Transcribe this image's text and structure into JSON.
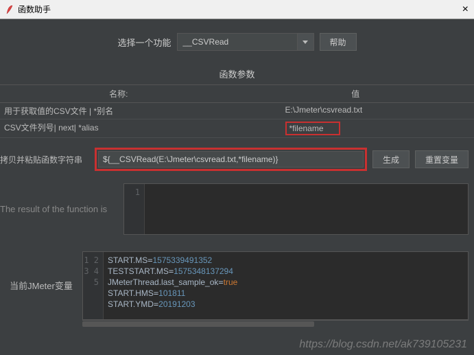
{
  "window": {
    "title": "函数助手"
  },
  "selector": {
    "label": "选择一个功能",
    "value": "__CSVRead",
    "help": "帮助"
  },
  "params": {
    "title": "函数参数",
    "head_name": "名称:",
    "head_value": "值",
    "rows": [
      {
        "name": "用于获取值的CSV文件 | *别名",
        "value": "E:\\Jmeter\\csvread.txt",
        "hl": false
      },
      {
        "name": "CSV文件列号| next| *alias",
        "value": "*filename",
        "hl": true
      }
    ]
  },
  "funcstr": {
    "label": "拷贝并粘贴函数字符串",
    "value": "${__CSVRead(E:\\Jmeter\\csvread.txt,*filename)}",
    "generate": "生成",
    "reset": "重置变量"
  },
  "result": {
    "label": "The result of the function is",
    "lines": [
      ""
    ]
  },
  "vars": {
    "label": "当前JMeter变量",
    "lines": [
      {
        "k": "START.MS",
        "v": "1575339491352"
      },
      {
        "k": "TESTSTART.MS",
        "v": "1575348137294"
      },
      {
        "k": "JMeterThread.last_sample_ok",
        "v": "true",
        "bool": true
      },
      {
        "k": "START.HMS",
        "v": "101811"
      },
      {
        "k": "START.YMD",
        "v": "20191203"
      }
    ]
  },
  "watermark": "https://blog.csdn.net/ak739105231"
}
